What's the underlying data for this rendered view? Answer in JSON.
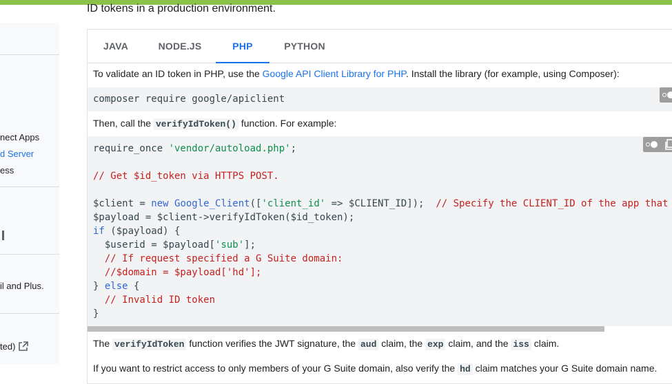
{
  "intro_line": "ID tokens in a production environment.",
  "sidebar": {
    "items": [
      {
        "label": "nect Apps",
        "active": false
      },
      {
        "label": "d Server",
        "active": true
      },
      {
        "label": "ess",
        "active": false
      },
      {
        "label": "il and Plus.",
        "active": false
      },
      {
        "label": "ted)",
        "active": false
      }
    ]
  },
  "tabs": [
    {
      "label": "JAVA",
      "active": false
    },
    {
      "label": "NODE.JS",
      "active": false
    },
    {
      "label": "PHP",
      "active": true
    },
    {
      "label": "PYTHON",
      "active": false
    }
  ],
  "content": {
    "p1_before": "To validate an ID token in PHP, use the ",
    "p1_link": "Google API Client Library for PHP",
    "p1_after": ". Install the library (for example, using Composer):",
    "code1": "composer require google/apiclient",
    "p2_before": "Then, call the ",
    "p2_code": "verifyIdToken()",
    "p2_after": " function. For example:",
    "code2": {
      "l1_a": "require_once ",
      "l1_str": "'vendor/autoload.php'",
      "l1_b": ";",
      "l2": "// Get $id_token via HTTPS POST.",
      "l3_a": "$client = ",
      "l3_kw": "new",
      "l3_fn": " Google_Client",
      "l3_b": "([",
      "l3_str": "'client_id'",
      "l3_c": " => $CLIENT_ID]);  ",
      "l3_cm": "// Specify the CLIENT_ID of the app that acces",
      "l4": "$payload = $client->verifyIdToken($id_token);",
      "l5_kw": "if",
      "l5_b": " ($payload) {",
      "l6_a": "  $userid = $payload[",
      "l6_str": "'sub'",
      "l6_b": "];",
      "l7": "  // If request specified a G Suite domain:",
      "l8": "  //$domain = $payload['hd'];",
      "l9_a": "} ",
      "l9_kw": "else",
      "l9_b": " {",
      "l10": "  // Invalid ID token",
      "l11": "}"
    },
    "p3_a": "The ",
    "p3_c1": "verifyIdToken",
    "p3_b": " function verifies the JWT signature, the ",
    "p3_c2": "aud",
    "p3_c": " claim, the ",
    "p3_c3": "exp",
    "p3_d": " claim, and the ",
    "p3_c4": "iss",
    "p3_e": " claim.",
    "p4_a": "If you want to restrict access to only members of your G Suite domain, also verify the ",
    "p4_c": "hd",
    "p4_b": " claim matches your G Suite domain name."
  },
  "icons": {
    "external_link": "external-link-icon",
    "copy": "copy-icon",
    "toggle": "toggle-theme-icon"
  },
  "colors": {
    "accent": "#8bc34a",
    "link": "#1a73e8"
  }
}
